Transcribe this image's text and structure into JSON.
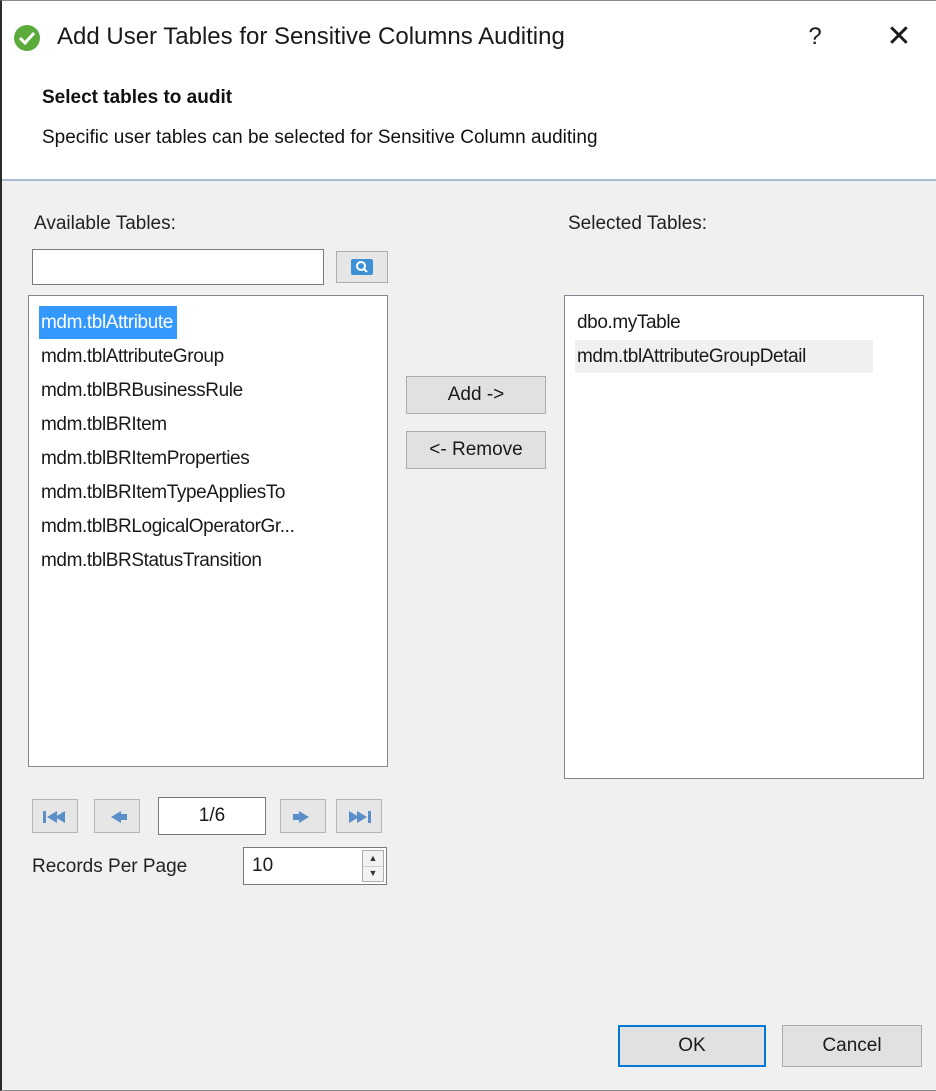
{
  "window": {
    "title": "Add User Tables for Sensitive Columns Auditing",
    "help_label": "?",
    "close_label": "✕"
  },
  "header": {
    "title": "Select tables to audit",
    "description": "Specific user tables can be selected for Sensitive Column auditing"
  },
  "available": {
    "label": "Available Tables:",
    "search_value": "",
    "items": [
      "mdm.tblAttribute",
      "mdm.tblAttributeGroup",
      "mdm.tblBRBusinessRule",
      "mdm.tblBRItem",
      "mdm.tblBRItemProperties",
      "mdm.tblBRItemTypeAppliesTo",
      "mdm.tblBRLogicalOperatorGr...",
      "mdm.tblBRStatusTransition"
    ],
    "selected_index": 0
  },
  "selected": {
    "label": "Selected Tables:",
    "items": [
      "dbo.myTable",
      "mdm.tblAttributeGroupDetail"
    ]
  },
  "actions": {
    "add_label": "Add ->",
    "remove_label": "<- Remove"
  },
  "pager": {
    "page_display": "1/6",
    "records_label": "Records Per Page",
    "records_value": "10"
  },
  "footer": {
    "ok_label": "OK",
    "cancel_label": "Cancel"
  },
  "colors": {
    "selection": "#3399ff",
    "accent": "#0078d7",
    "title_icon": "#5aab3c"
  }
}
